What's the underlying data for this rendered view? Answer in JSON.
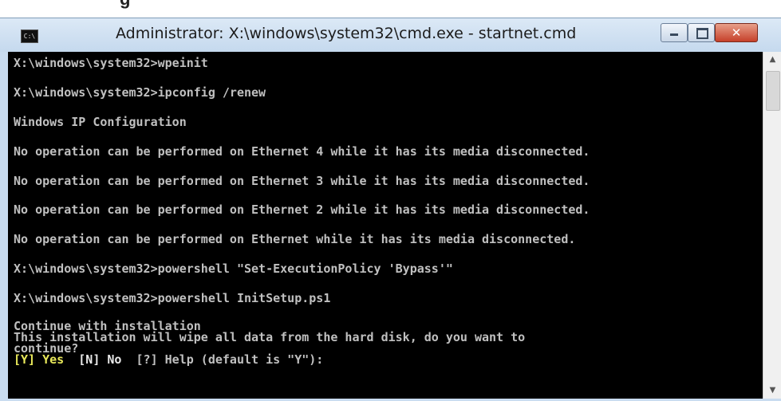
{
  "page": {
    "top_fragment": "g"
  },
  "window": {
    "title": "Administrator: X:\\windows\\system32\\cmd.exe - startnet.cmd",
    "app_icon_label": "C:\\",
    "buttons": {
      "minimize": "minimize",
      "maximize": "maximize",
      "close": "✕"
    }
  },
  "console": {
    "lines": [
      "X:\\windows\\system32>wpeinit",
      "X:\\windows\\system32>ipconfig /renew",
      "Windows IP Configuration",
      "No operation can be performed on Ethernet 4 while it has its media disconnected.",
      "No operation can be performed on Ethernet 3 while it has its media disconnected.",
      "No operation can be performed on Ethernet 2 while it has its media disconnected.",
      "No operation can be performed on Ethernet while it has its media disconnected.",
      "X:\\windows\\system32>powershell \"Set-ExecutionPolicy 'Bypass'\"",
      "X:\\windows\\system32>powershell InitSetup.ps1",
      "Continue with installation",
      "This installation will wipe all data from the hard disk, do you want to",
      "continue?"
    ],
    "prompt": {
      "yes": "[Y] Yes",
      "no": "[N] No",
      "rest": "[?] Help (default is \"Y\"):"
    }
  },
  "scrollbar": {
    "up": "▲",
    "down": "▼"
  }
}
